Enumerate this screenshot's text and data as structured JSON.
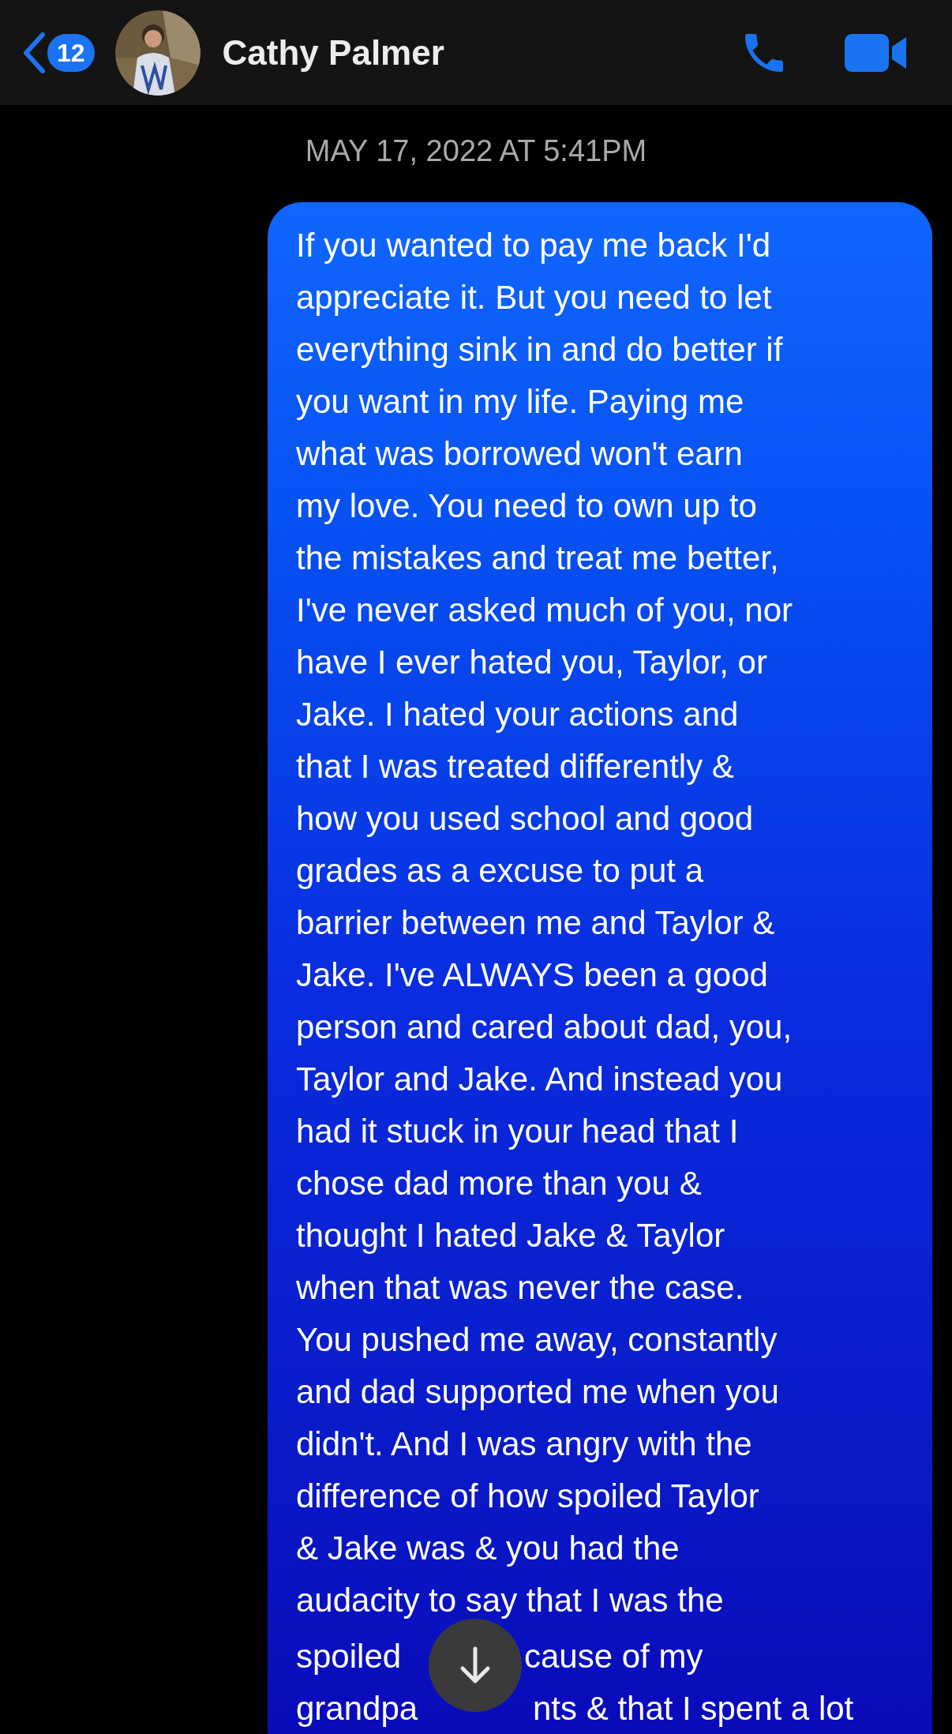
{
  "header": {
    "unread_count": "12",
    "contact_name": "Cathy Palmer"
  },
  "timestamp": "MAY 17, 2022 AT 5:41PM",
  "message": {
    "lines": [
      "If you wanted to pay me back I'd",
      "appreciate it. But you need to let",
      "everything sink in and do better if",
      "you want in my life. Paying me",
      "what was borrowed won't earn",
      "my love. You need to own up to",
      "the mistakes and treat me better,",
      "I've never asked much of you, nor",
      "have I ever hated you, Taylor, or",
      "Jake. I hated your actions and",
      "that I was treated differently &",
      "how you used school and good",
      "grades as a excuse to put a",
      "barrier between me and Taylor &",
      "Jake. I've ALWAYS been a good",
      "person and cared about dad, you,",
      "Taylor and Jake. And instead you",
      "had it stuck in your head that I",
      "chose dad more than you &",
      "thought I hated Jake & Taylor",
      "when that was never the case.",
      "You pushed me away, constantly",
      "and dad supported me when you",
      "didn't. And I was angry with the",
      "difference of how spoiled Taylor",
      "& Jake was & you had the",
      "audacity to say that I was the"
    ],
    "covered_lines": [
      {
        "before": "spoiled",
        "after": "cause of my"
      },
      {
        "before": "grandpa",
        "after": "nts & that I spent a lot"
      }
    ]
  }
}
